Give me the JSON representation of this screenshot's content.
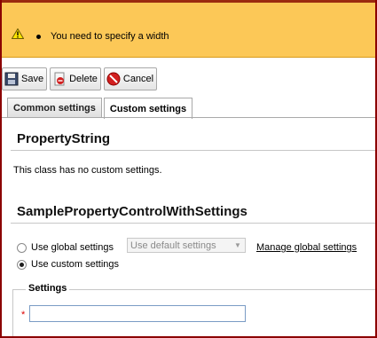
{
  "warning": {
    "message": "You need to specify a width",
    "icon": "warning-icon"
  },
  "toolbar": {
    "save_label": "Save",
    "delete_label": "Delete",
    "cancel_label": "Cancel"
  },
  "tabs": [
    {
      "label": "Common settings",
      "active": false
    },
    {
      "label": "Custom settings",
      "active": true
    }
  ],
  "sections": {
    "property_string": {
      "title": "PropertyString",
      "text": "This class has no custom settings."
    },
    "sample": {
      "title": "SamplePropertyControlWithSettings",
      "use_global_label": "Use global settings",
      "global_select_value": "Use default settings",
      "manage_link": "Manage global settings",
      "use_custom_label": "Use custom settings",
      "selected_option": "Use custom settings"
    }
  },
  "settings_fieldset": {
    "legend": "Settings",
    "required_marker": "*",
    "field_value": ""
  },
  "colors": {
    "warning_bg": "#fcc857",
    "frame": "#8b0000",
    "required": "#dd0000"
  }
}
